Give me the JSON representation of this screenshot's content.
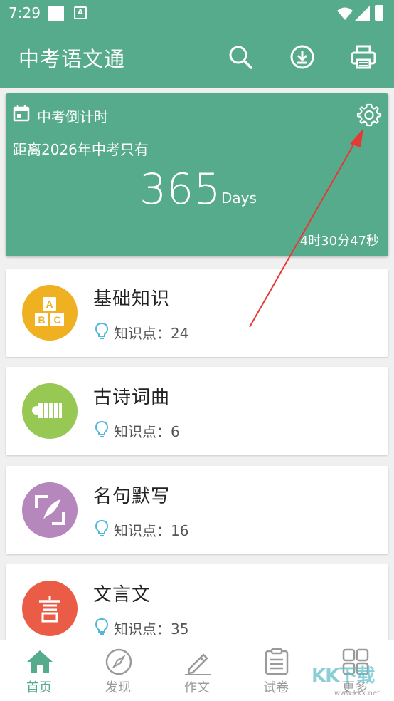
{
  "status_bar": {
    "time": "7:29"
  },
  "app_bar": {
    "title": "中考语文通",
    "actions": [
      {
        "name": "search-icon"
      },
      {
        "name": "download-icon"
      },
      {
        "name": "print-icon"
      }
    ]
  },
  "countdown": {
    "title": "中考倒计时",
    "subtitle": "距离2026年中考只有",
    "days": "365",
    "unit": "Days",
    "timer": "4时30分47秒"
  },
  "categories": [
    {
      "name": "基础知识",
      "points": "知识点：24",
      "color": "#efb021",
      "icon": "abc-blocks-icon"
    },
    {
      "name": "古诗词曲",
      "points": "知识点：6",
      "color": "#96c853",
      "icon": "bamboo-scroll-icon"
    },
    {
      "name": "名句默写",
      "points": "知识点：16",
      "color": "#b587bc",
      "icon": "quill-pen-icon"
    },
    {
      "name": "文言文",
      "points": "知识点：35",
      "color": "#ea5c45",
      "icon": "yan-character-icon"
    }
  ],
  "bottom_nav": [
    {
      "label": "首页",
      "icon": "home-icon",
      "active": true
    },
    {
      "label": "发现",
      "icon": "compass-icon",
      "active": false
    },
    {
      "label": "作文",
      "icon": "pencil-icon",
      "active": false
    },
    {
      "label": "试卷",
      "icon": "clipboard-icon",
      "active": false
    },
    {
      "label": "更多",
      "icon": "grid-icon",
      "active": false
    }
  ],
  "watermark": {
    "text": "KK下载",
    "url": "www.kkx.net"
  },
  "colors": {
    "primary": "#55ab8c",
    "annotation_arrow": "#e53935"
  }
}
